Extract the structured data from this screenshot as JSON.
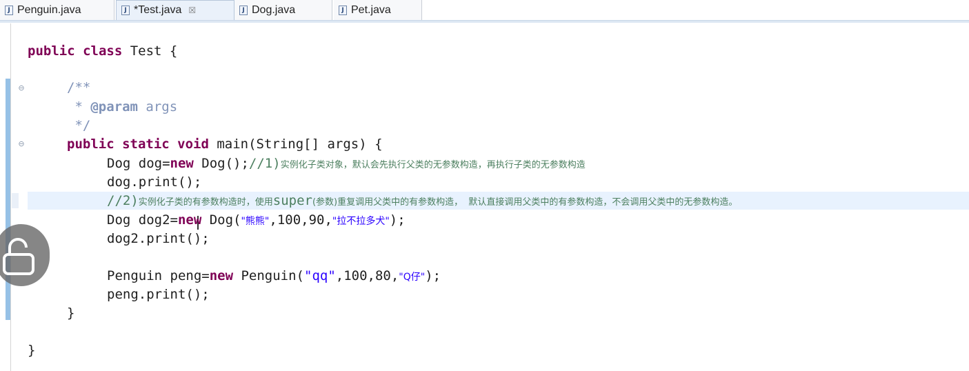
{
  "tabs": [
    {
      "label": "Penguin.java",
      "icon": "java-file-icon",
      "active": false
    },
    {
      "label": "*Test.java",
      "icon": "java-file-icon",
      "active": true,
      "close": "☒"
    },
    {
      "label": "Dog.java",
      "icon": "java-file-icon",
      "active": false
    },
    {
      "label": "Pet.java",
      "icon": "java-file-icon",
      "active": false
    }
  ],
  "file_icon_letter": "J",
  "code": {
    "l1": {
      "kw": "public class",
      "rest": " Test {"
    },
    "l2": {
      "text": "/**"
    },
    "l3": {
      "star": " * ",
      "tag": "@param",
      "rest": " args"
    },
    "l4": {
      "text": " */"
    },
    "l5": {
      "kw": "public static void",
      "rest": " main(String[] args) {"
    },
    "l6": {
      "a": "Dog dog=",
      "kw": "new",
      "b": " Dog();",
      "c": "//1)",
      "zh": "实例化子类对象，默认会先执行父类的无参数构造，再执行子类的无参数构造"
    },
    "l7": {
      "text": "dog.print();"
    },
    "l8": {
      "c": "//2)",
      "zh1": "实例化子类的有参数构造时，使用",
      "c2": "super",
      "zh2": "(参数)重复调用父类中的有参数构造，  默认直接调用父类中的有参数构造，不会调用父类中的无参数构造。"
    },
    "l9": {
      "a": "Dog dog2=",
      "kw": "new",
      "b": " Dog(",
      "s1": "\"熊熊\"",
      "c": ",100,90,",
      "s2": "\"拉不拉多犬\"",
      "d": ");"
    },
    "l10": {
      "text": "dog2.print();"
    },
    "l11": {
      "a": "Penguin peng=",
      "kw": "new",
      "b": " Penguin(",
      "s1": "\"qq\"",
      "c": ",100,80,",
      "s2": "\"Q仔\"",
      "d": ");"
    },
    "l12": {
      "text": "peng.print();"
    },
    "l13": {
      "text": "}"
    },
    "l14": {
      "text": "}"
    }
  },
  "fold_symbol": "⊖",
  "colors": {
    "keyword": "#7f0055",
    "comment": "#4c7f5f",
    "javadoc": "#8093b8",
    "string": "#2a00ff",
    "current_line": "#e8f2fe"
  }
}
